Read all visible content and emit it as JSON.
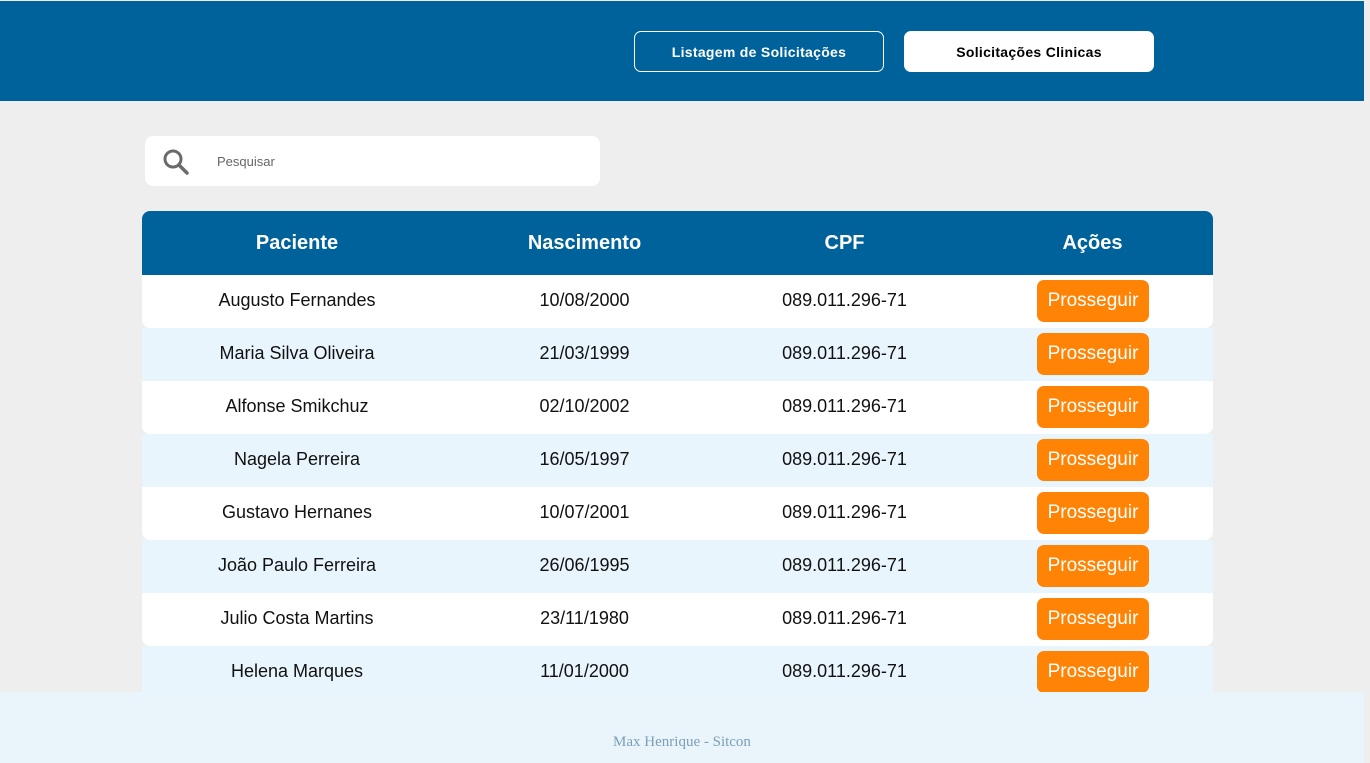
{
  "header": {
    "nav_listagem": "Listagem de Solicitações",
    "nav_clinicas": "Solicitações Clinicas"
  },
  "search": {
    "placeholder": "Pesquisar",
    "icon": "search-icon"
  },
  "table": {
    "columns": [
      "Paciente",
      "Nascimento",
      "CPF",
      "Ações"
    ],
    "rows": [
      {
        "paciente": "Augusto Fernandes",
        "nascimento": "10/08/2000",
        "cpf": "089.011.296-71",
        "acao": "Prosseguir"
      },
      {
        "paciente": "Maria Silva Oliveira",
        "nascimento": "21/03/1999",
        "cpf": "089.011.296-71",
        "acao": "Prosseguir"
      },
      {
        "paciente": "Alfonse Smikchuz",
        "nascimento": "02/10/2002",
        "cpf": "089.011.296-71",
        "acao": "Prosseguir"
      },
      {
        "paciente": "Nagela Perreira",
        "nascimento": "16/05/1997",
        "cpf": "089.011.296-71",
        "acao": "Prosseguir"
      },
      {
        "paciente": "Gustavo Hernanes",
        "nascimento": "10/07/2001",
        "cpf": "089.011.296-71",
        "acao": "Prosseguir"
      },
      {
        "paciente": "João Paulo Ferreira",
        "nascimento": "26/06/1995",
        "cpf": "089.011.296-71",
        "acao": "Prosseguir"
      },
      {
        "paciente": "Julio Costa Martins",
        "nascimento": "23/11/1980",
        "cpf": "089.011.296-71",
        "acao": "Prosseguir"
      },
      {
        "paciente": "Helena Marques",
        "nascimento": "11/01/2000",
        "cpf": "089.011.296-71",
        "acao": "Prosseguir"
      }
    ]
  },
  "footer": {
    "text": "Max Henrique - Sitcon"
  },
  "colors": {
    "primary": "#00629b",
    "accent": "#ff8406",
    "row_alt": "#e9f5fc",
    "background": "#eeeeee"
  }
}
